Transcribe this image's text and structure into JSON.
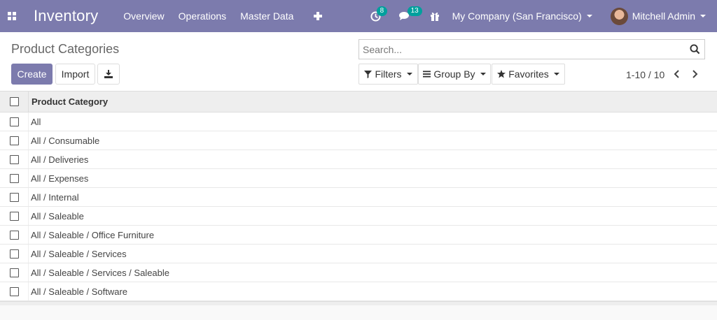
{
  "navbar": {
    "app_title": "Inventory",
    "menu": [
      "Overview",
      "Operations",
      "Master Data"
    ],
    "activity_count": "8",
    "message_count": "13",
    "company": "My Company (San Francisco)",
    "user": "Mitchell Admin"
  },
  "control_panel": {
    "breadcrumb": "Product Categories",
    "create_label": "Create",
    "import_label": "Import",
    "search_placeholder": "Search...",
    "filters_label": "Filters",
    "groupby_label": "Group By",
    "favorites_label": "Favorites",
    "pager": "1-10 / 10"
  },
  "table": {
    "column_header": "Product Category",
    "rows": [
      "All",
      "All / Consumable",
      "All / Deliveries",
      "All / Expenses",
      "All / Internal",
      "All / Saleable",
      "All / Saleable / Office Furniture",
      "All / Saleable / Services",
      "All / Saleable / Services / Saleable",
      "All / Saleable / Software"
    ]
  },
  "colors": {
    "navbar": "#7c7bad",
    "badge": "#00a09d",
    "primary": "#7c7bad"
  }
}
